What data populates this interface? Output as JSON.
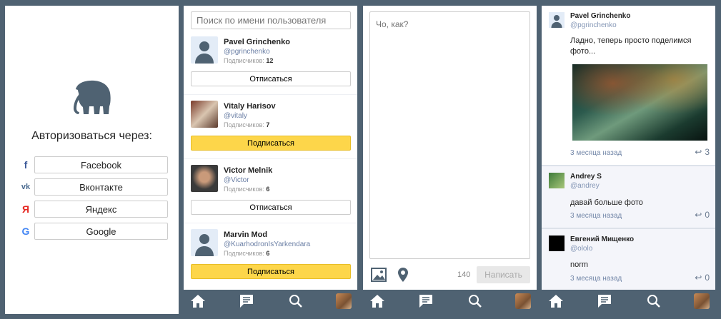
{
  "auth": {
    "title": "Авторизоваться через:",
    "providers": [
      {
        "label": "Facebook",
        "icon": "f"
      },
      {
        "label": "Вконтакте",
        "icon": "vk"
      },
      {
        "label": "Яндекс",
        "icon": "Я"
      },
      {
        "label": "Google",
        "icon": "G"
      }
    ]
  },
  "users": {
    "search_placeholder": "Поиск по имени пользователя",
    "followers_label": "Подписчиков:",
    "list": [
      {
        "name": "Pavel Grinchenko",
        "handle": "@pgrinchenko",
        "followers": "12",
        "button": "Отписаться",
        "following": true
      },
      {
        "name": "Vitaly Harisov",
        "handle": "@vitaly",
        "followers": "7",
        "button": "Подписаться",
        "following": false
      },
      {
        "name": "Victor Melnik",
        "handle": "@Victor",
        "followers": "6",
        "button": "Отписаться",
        "following": true
      },
      {
        "name": "Marvin Mod",
        "handle": "@KuarhodronIsYarkendara",
        "followers": "6",
        "button": "Подписаться",
        "following": false
      }
    ]
  },
  "compose": {
    "placeholder": "Чо, как?",
    "counter": "140",
    "submit": "Написать"
  },
  "feed": [
    {
      "name": "Pavel Grinchenko",
      "handle": "@pgrinchenko",
      "text": "Ладно, теперь просто поделимся фото...",
      "date": "3 месяца назад",
      "replies": "3"
    },
    {
      "name": "Andrey S",
      "handle": "@andrey",
      "text": "давай больше фото",
      "date": "3 месяца назад",
      "replies": "0"
    },
    {
      "name": "Евгений Мищенко",
      "handle": "@ololo",
      "text": "norm",
      "date": "3 месяца назад",
      "replies": "0"
    }
  ],
  "colors": {
    "background": "#4f6272",
    "yellow": "#fdd64a",
    "link": "#6b7fa5"
  }
}
